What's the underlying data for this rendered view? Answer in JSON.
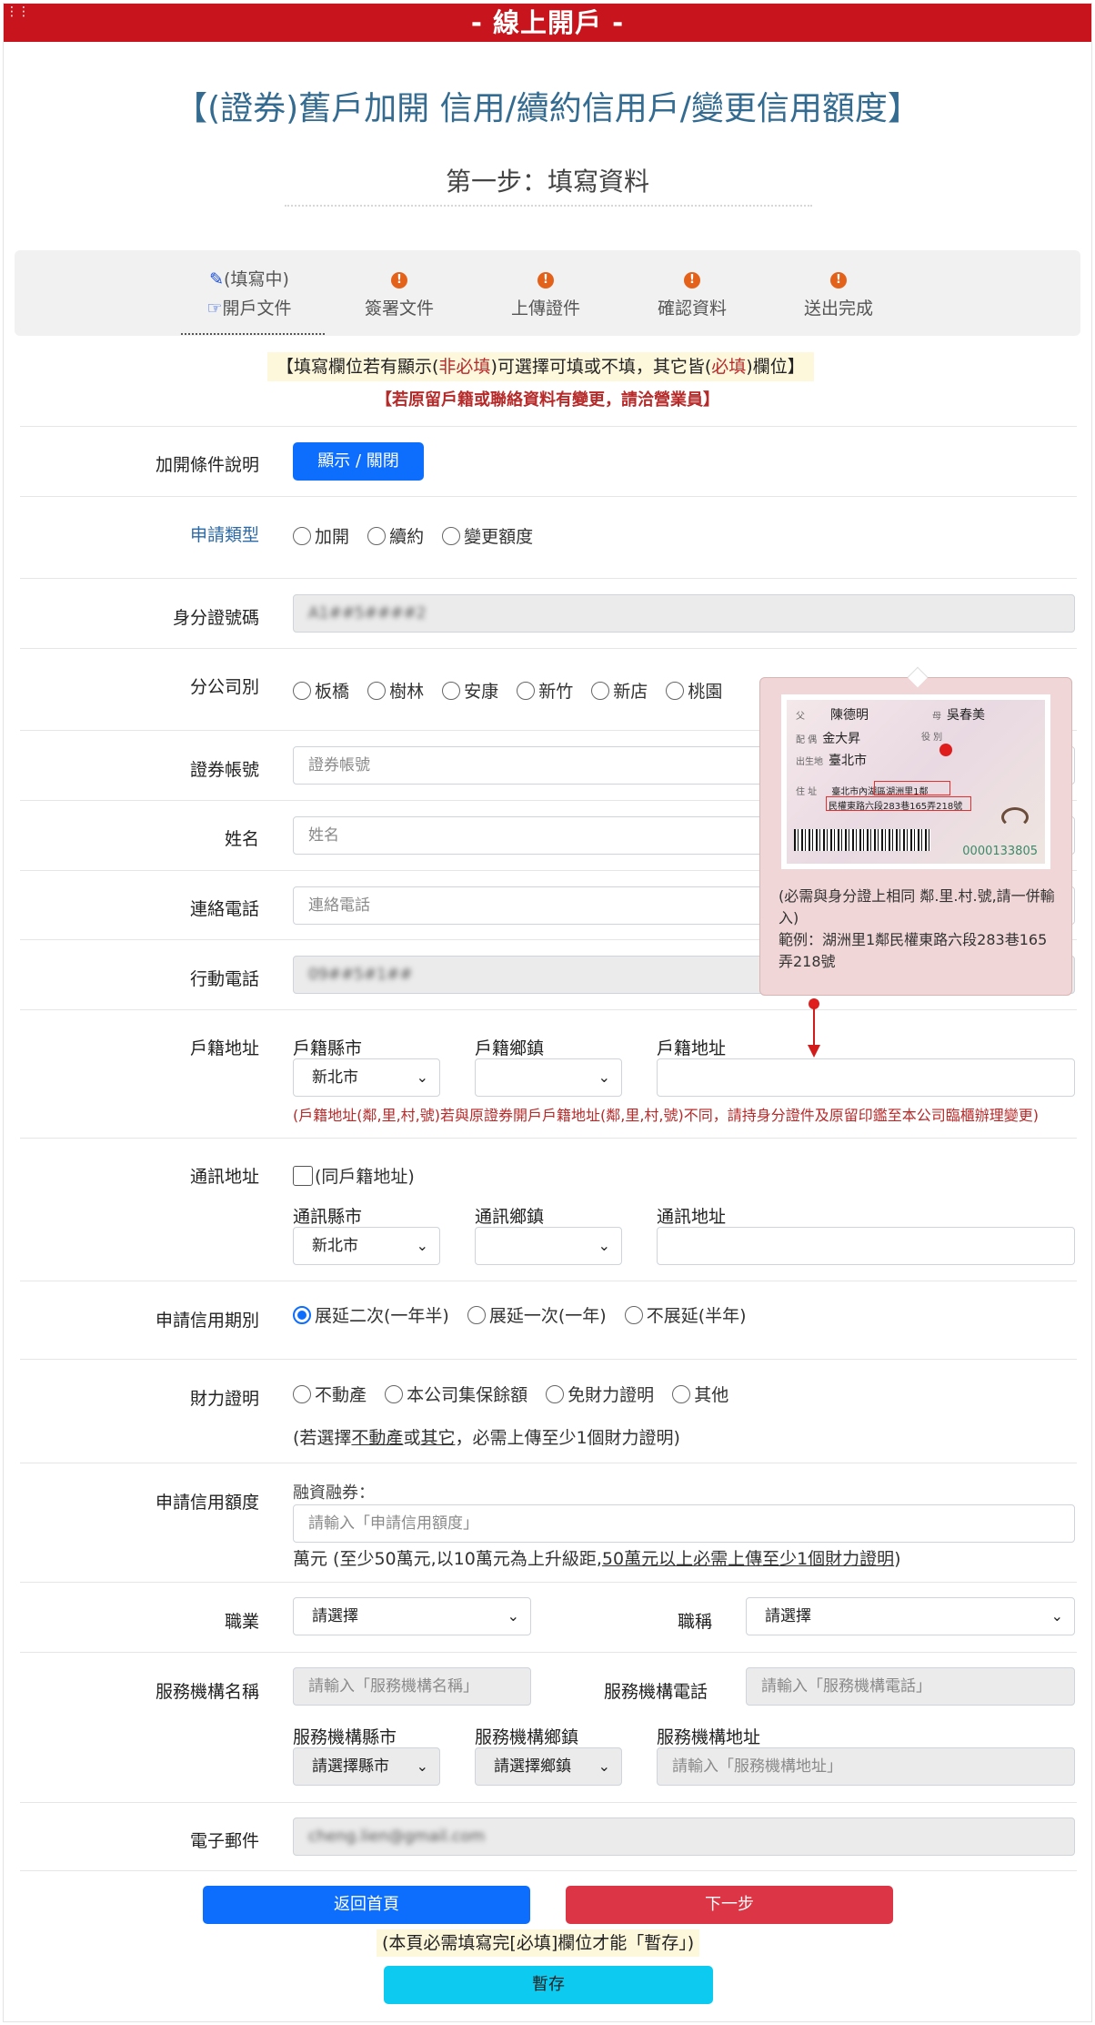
{
  "header": {
    "title": "-  線上開戶  -"
  },
  "page_title": "【(證券)舊戶加開 信用/續約信用戶/變更信用額度】",
  "step_title": "第一步：填寫資料",
  "steps": [
    {
      "status": "(填寫中)",
      "label": "開戶文件"
    },
    {
      "status": "!",
      "label": "簽署文件"
    },
    {
      "status": "!",
      "label": "上傳證件"
    },
    {
      "status": "!",
      "label": "確認資料"
    },
    {
      "status": "!",
      "label": "送出完成"
    }
  ],
  "notice": {
    "part1": "【填寫欄位若有顯示(",
    "optional": "非必填",
    "part2": ")可選擇可填或不填，其它皆(",
    "required": "必填",
    "part3": ")欄位】",
    "line2": "【若原留戶籍或聯絡資料有變更，請洽營業員】"
  },
  "form": {
    "conditions": {
      "label": "加開條件說明",
      "button": "顯示 / 關閉"
    },
    "apply_type": {
      "label": "申請類型",
      "options": [
        "加開",
        "續約",
        "變更額度"
      ]
    },
    "id_number": {
      "label": "身分證號碼",
      "value": "A1##5####2"
    },
    "branch": {
      "label": "分公司別",
      "options": [
        "板橋",
        "樹林",
        "安康",
        "新竹",
        "新店",
        "桃園"
      ]
    },
    "account": {
      "label": "證券帳號",
      "placeholder": "證券帳號"
    },
    "name": {
      "label": "姓名",
      "placeholder": "姓名"
    },
    "phone": {
      "label": "連絡電話",
      "placeholder": "連絡電話"
    },
    "mobile": {
      "label": "行動電話",
      "value": "09##5#1##"
    },
    "household": {
      "label": "戶籍地址",
      "city_label": "戶籍縣市",
      "city_value": "新北市",
      "town_label": "戶籍鄉鎮",
      "town_value": "",
      "addr_label": "戶籍地址",
      "note": "(戶籍地址(鄰,里,村,號)若與原證券開戶戶籍地址(鄰,里,村,號)不同，請持身分證件及原留印鑑至本公司臨櫃辦理變更)"
    },
    "mailing": {
      "label": "通訊地址",
      "same_label": "(同戶籍地址)",
      "city_label": "通訊縣市",
      "city_value": "新北市",
      "town_label": "通訊鄉鎮",
      "town_value": "",
      "addr_label": "通訊地址"
    },
    "credit_period": {
      "label": "申請信用期別",
      "options": [
        "展延二次(一年半)",
        "展延一次(一年)",
        "不展延(半年)"
      ],
      "selected": 0
    },
    "financial": {
      "label": "財力證明",
      "options": [
        "不動產",
        "本公司集保餘額",
        "免財力證明",
        "其他"
      ],
      "note_a": "(若選擇",
      "note_u1": "不動產",
      "note_b": "或",
      "note_u2": "其它",
      "note_c": "，必需上傳至少1個財力證明)"
    },
    "credit_amount": {
      "label": "申請信用額度",
      "sub_label": "融資融券：",
      "placeholder": "請輸入「申請信用額度」",
      "note_a": "萬元 (至少50萬元,以10萬元為上升級距,",
      "note_u": "50萬元以上必需上傳至少1個財力證明",
      "note_b": ")"
    },
    "occupation": {
      "label": "職業",
      "value": "請選擇",
      "title_label": "職稱",
      "title_value": "請選擇"
    },
    "employer": {
      "label": "服務機構名稱",
      "placeholder": "請輸入「服務機構名稱」",
      "phone_label": "服務機構電話",
      "phone_placeholder": "請輸入「服務機構電話」",
      "city_label": "服務機構縣市",
      "city_value": "請選擇縣市",
      "town_label": "服務機構鄉鎮",
      "town_value": "請選擇鄉鎮",
      "addr_label": "服務機構地址",
      "addr_placeholder": "請輸入「服務機構地址」"
    },
    "email": {
      "label": "電子郵件",
      "value": "cheng.lien@gmail.com"
    }
  },
  "tooltip": {
    "card": {
      "father_t": "父",
      "father": "陳德明",
      "mother_t": "母",
      "mother": "吳春美",
      "spouse_t": "配 偶",
      "spouse": "金大昇",
      "service_t": "役 別",
      "birth_t": "出生地",
      "birth": "臺北市",
      "addr_t": "住 址",
      "addr1": "臺北市內湖區湖洲里1鄰",
      "addr2": "民權東路六段283巷165弄218號",
      "number": "0000133805"
    },
    "text1": "(必需與身分證上相同 鄰.里.村.號,請一併輸入)",
    "text2": "範例：湖洲里1鄰民權東路六段283巷165弄218號"
  },
  "footer": {
    "home_button": "返回首頁",
    "next_button": "下一步",
    "save_note": "(本頁必需填寫完[必填]欄位才能「暫存」)",
    "save_button": "暫存"
  },
  "colors": {
    "brand_red": "#c8141c",
    "title_blue": "#346b91",
    "primary": "#0d6efd",
    "danger": "#dc3545",
    "info": "#0dcaf0"
  }
}
